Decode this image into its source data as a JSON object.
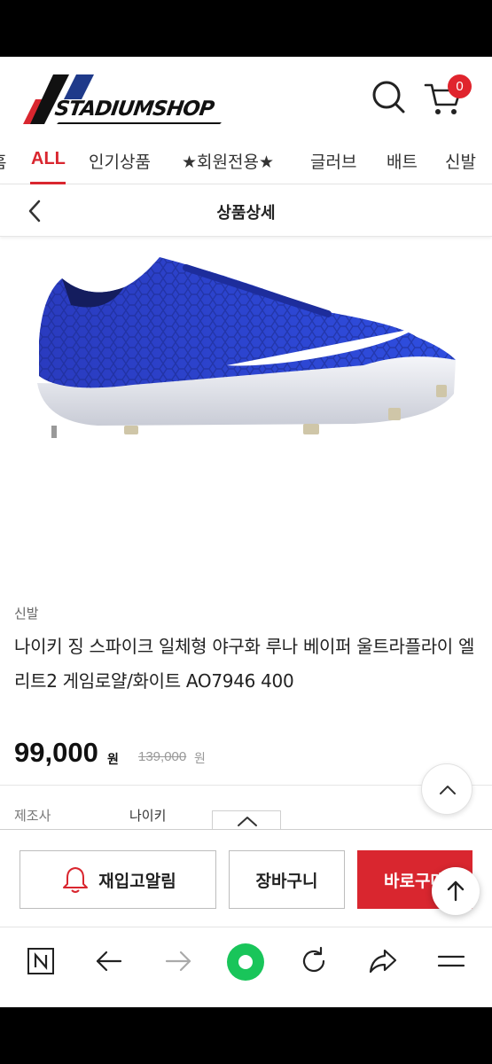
{
  "header": {
    "logo_text": "STADIUMSHOP",
    "cart_count": "0",
    "icons": [
      "search-icon",
      "cart-icon"
    ]
  },
  "category_nav": {
    "items": [
      {
        "label": "홈",
        "active": false
      },
      {
        "label": "ALL",
        "active": true
      },
      {
        "label": "인기상품",
        "active": false
      },
      {
        "label": "★회원전용★",
        "active": false
      },
      {
        "label": "글러브",
        "active": false
      },
      {
        "label": "배트",
        "active": false
      },
      {
        "label": "신발",
        "active": false
      }
    ]
  },
  "page_bar": {
    "title": "상품상세",
    "back_icon": "chevron-left-icon"
  },
  "product": {
    "category": "신발",
    "title": "나이키 징 스파이크 일체형 야구화 루나 베이퍼 울트라플라이 엘리트2 게임로얄/화이트 AO7946 400",
    "price": "99,000",
    "price_unit": "원",
    "original_price": "139,000",
    "original_unit": "원",
    "specs": [
      {
        "label": "제조사",
        "value": "나이키"
      }
    ]
  },
  "actions": {
    "restock_label": "재입고알림",
    "cart_label": "장바구니",
    "buy_label": "바로구매"
  },
  "browser_toolbar": {
    "icons": [
      "naver-home-icon",
      "back-arrow-icon",
      "forward-arrow-icon",
      "green-dot-icon",
      "refresh-icon",
      "share-icon",
      "menu-icon"
    ]
  },
  "colors": {
    "accent": "#d9262f",
    "badge": "#e0242d",
    "shoe_blue": "#2b3fd1"
  }
}
